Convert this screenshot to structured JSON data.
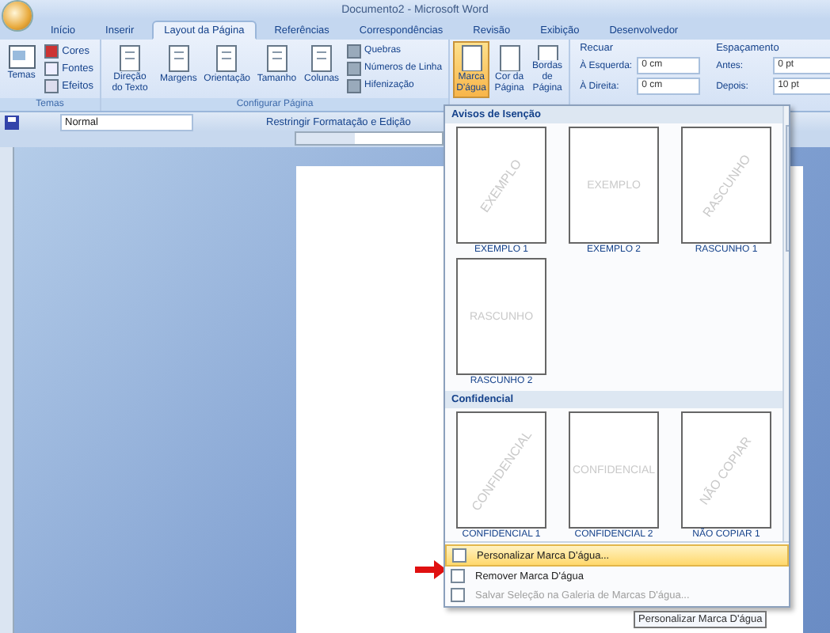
{
  "window": {
    "title": "Documento2 - Microsoft Word"
  },
  "tabs": [
    {
      "label": "Início",
      "selected": false
    },
    {
      "label": "Inserir",
      "selected": false
    },
    {
      "label": "Layout da Página",
      "selected": true
    },
    {
      "label": "Referências",
      "selected": false
    },
    {
      "label": "Correspondências",
      "selected": false
    },
    {
      "label": "Revisão",
      "selected": false
    },
    {
      "label": "Exibição",
      "selected": false
    },
    {
      "label": "Desenvolvedor",
      "selected": false
    }
  ],
  "themes_group": {
    "label": "Temas",
    "large": "Temas",
    "small": [
      "Cores",
      "Fontes",
      "Efeitos"
    ]
  },
  "page_setup_group": {
    "label": "Configurar Página",
    "large": [
      "Direção do Texto",
      "Margens",
      "Orientação",
      "Tamanho",
      "Colunas"
    ],
    "small": [
      "Quebras",
      "Números de Linha",
      "Hifenização"
    ]
  },
  "background_group": {
    "buttons": [
      {
        "label": "Marca D'água",
        "selected": true
      },
      {
        "label": "Cor da Página",
        "selected": false
      },
      {
        "label": "Bordas de Página",
        "selected": false
      }
    ]
  },
  "paragraph_group": {
    "indent": {
      "title": "Recuar",
      "fields": [
        {
          "label": "À Esquerda:",
          "value": "0 cm"
        },
        {
          "label": "À Direita:",
          "value": "0 cm"
        }
      ]
    },
    "spacing": {
      "title": "Espaçamento",
      "fields": [
        {
          "label": "Antes:",
          "value": "0 pt"
        },
        {
          "label": "Depois:",
          "value": "10 pt"
        }
      ]
    }
  },
  "quick_toolbar": {
    "style": "Normal",
    "restrict": "Restringir Formatação e Edição"
  },
  "watermark_gallery": {
    "sections": [
      {
        "title": "Avisos de Isenção",
        "items": [
          {
            "label": "EXEMPLO 1",
            "watermark": "EXEMPLO",
            "kind": "diagonal"
          },
          {
            "label": "EXEMPLO 2",
            "watermark": "EXEMPLO",
            "kind": "horizontal"
          },
          {
            "label": "RASCUNHO 1",
            "watermark": "RASCUNHO",
            "kind": "diagonal"
          },
          {
            "label": "RASCUNHO 2",
            "watermark": "RASCUNHO",
            "kind": "horizontal"
          }
        ]
      },
      {
        "title": "Confidencial",
        "items": [
          {
            "label": "CONFIDENCIAL 1",
            "watermark": "CONFIDENCIAL",
            "kind": "diagonal"
          },
          {
            "label": "CONFIDENCIAL 2",
            "watermark": "CONFIDENCIAL",
            "kind": "horizontal"
          },
          {
            "label": "NÃO COPIAR 1",
            "watermark": "NÃO COPIAR",
            "kind": "diagonal"
          }
        ]
      }
    ],
    "menu": [
      {
        "label": "Personalizar Marca D'água...",
        "highlighted": true,
        "disabled": false
      },
      {
        "label": "Remover Marca D'água",
        "highlighted": false,
        "disabled": false
      },
      {
        "label": "Salvar Seleção na Galeria de Marcas D'água...",
        "highlighted": false,
        "disabled": true
      }
    ],
    "tooltip": "Personalizar Marca D'água"
  }
}
